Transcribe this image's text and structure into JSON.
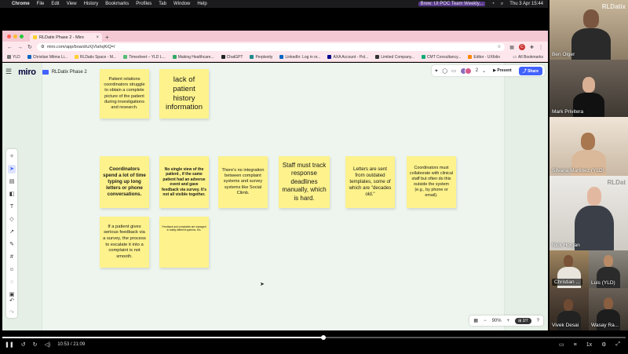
{
  "menubar": {
    "items": [
      "Chrome",
      "File",
      "Edit",
      "View",
      "History",
      "Bookmarks",
      "Profiles",
      "Tab",
      "Window",
      "Help"
    ],
    "meeting_badge": "Brew: UI POC Team Weekly...",
    "datetime": "Thu 3 Apr 15:44"
  },
  "browser": {
    "tab_title": "RLDatix Phase 2 - Miro",
    "url": "miro.com/app/board/uXjVIahqKiQ=/",
    "bookmarks": [
      "YLD",
      "Christian Mtima Li...",
      "RLDatix Space - M...",
      "Timesheet – YLD L...",
      "Making Healthcare...",
      "ChatGPT",
      "Perplexity",
      "LinkedIn: Log in or...",
      "AXA Account - Pol...",
      "Limited Company...",
      "CMT Consultancy...",
      "Editor - UXfolio"
    ],
    "all_bookmarks": "All Bookmarks",
    "profile_initial": "C"
  },
  "miro": {
    "logo": "miro",
    "board_name": "RLDatix Phase 2",
    "collaborator_count": "2",
    "present_label": "Present",
    "share_label": "Share",
    "zoom": "90%",
    "page_indicator": "2/7"
  },
  "stickies": [
    {
      "id": "s1",
      "text": "Patient relations coordinators struggle to obtain a complete picture of the patient during investigations and research."
    },
    {
      "id": "s2",
      "text": "lack of patient history information"
    },
    {
      "id": "s3",
      "text": "Coordinators spend a lot of time typing up long letters or phone conversations."
    },
    {
      "id": "s4",
      "text": "No single view of the patient , if the same patient had an adverse event and gave feedback via survey. It's not all visible together."
    },
    {
      "id": "s5",
      "text": "There's no integration between complaint systems and survey systems like Social Climb."
    },
    {
      "id": "s6",
      "text": "Staff must track response deadlines manually, which is hard."
    },
    {
      "id": "s7",
      "text": "Letters are sent from outdated templates, some of which are \"decades old.\""
    },
    {
      "id": "s8",
      "text": "Coordinators must collaborate with clinical staff but often do this outside the system (e.g., by phone or email)."
    },
    {
      "id": "s9",
      "text": "If a patient gives serious feedback via a survey, the process to escalate it into a complaint is not smooth."
    },
    {
      "id": "s10",
      "text": "Feedback and complaints are managed in totally different systems. Etc."
    }
  ],
  "video": {
    "time": "10:53 / 21:09",
    "speed": "1x",
    "progress_fraction": 0.515
  },
  "participants": [
    {
      "name": "Ben Olger",
      "watermark": "RLDatix"
    },
    {
      "name": "Mark Privitera"
    },
    {
      "name": "Silvana Martinez (YLD)"
    },
    {
      "name": "Nick Horgan",
      "watermark": "RLDat"
    },
    {
      "name": "Christian ...",
      "name2": "Luis (YLD)"
    },
    {
      "name": "Vivek Desai",
      "name2": "Wasay Ra..."
    }
  ]
}
